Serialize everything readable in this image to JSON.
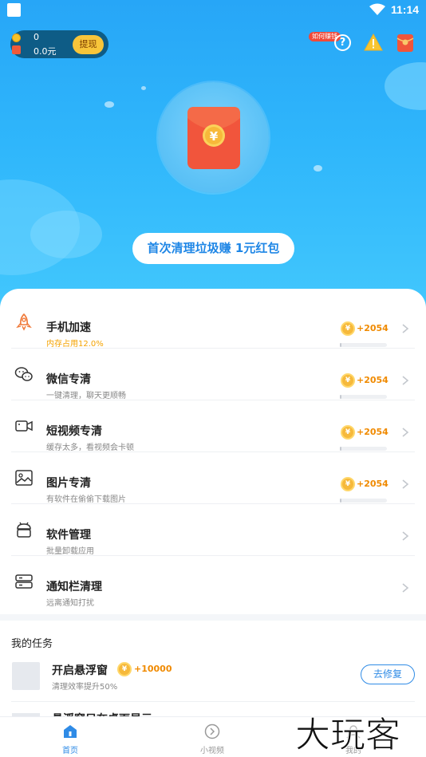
{
  "status_bar": {
    "time": "11:14"
  },
  "wallet": {
    "coins": "0",
    "money": "0.0元",
    "withdraw_label": "提现"
  },
  "header": {
    "earn_badge": "如何赚钱"
  },
  "hero": {
    "button_main": "首次清理垃圾赚 ",
    "button_accent": "1元红包"
  },
  "items": [
    {
      "title": "手机加速",
      "subtitle": "内存占用12.0%",
      "reward": "+2054",
      "icon": "rocket-icon"
    },
    {
      "title": "微信专清",
      "subtitle": "一键清理，聊天更顺畅",
      "reward": "+2054",
      "icon": "wechat-icon"
    },
    {
      "title": "短视频专清",
      "subtitle": "缓存太多，看视频会卡顿",
      "reward": "+2054",
      "icon": "video-icon"
    },
    {
      "title": "图片专清",
      "subtitle": "有软件在偷偷下载图片",
      "reward": "+2054",
      "icon": "image-icon"
    },
    {
      "title": "软件管理",
      "subtitle": "批量卸载应用",
      "icon": "android-icon"
    },
    {
      "title": "通知栏清理",
      "subtitle": "远离通知打扰",
      "icon": "notification-icon"
    }
  ],
  "tasks": {
    "title": "我的任务",
    "task1": {
      "name": "开启悬浮窗",
      "reward": "+10000",
      "subtitle": "清理效率提升50%",
      "button": "去修复"
    },
    "task2": {
      "name": "悬浮窗只在桌面显示"
    }
  },
  "nav": {
    "home": "首页",
    "video": "小视频",
    "mine": "我的"
  },
  "watermark": "大玩客",
  "colors": {
    "accent": "#2f8be6",
    "reward": "#f08a00",
    "hero_top": "#27a6f7"
  }
}
